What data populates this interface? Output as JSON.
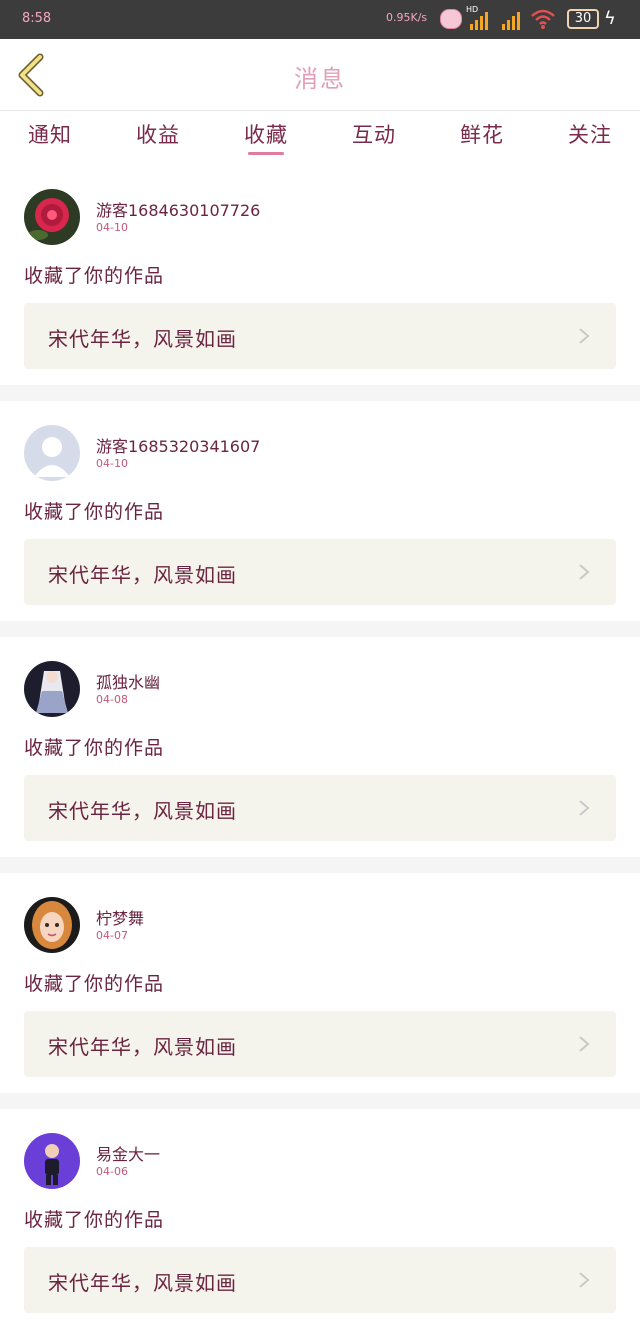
{
  "status_bar": {
    "time": "8:58",
    "net_speed": "0.95K/s",
    "hd_label": "HD",
    "battery": "30",
    "signal_color": "#f5a623"
  },
  "header": {
    "title": "消息",
    "back_icon": "chevron-left-icon",
    "back_color": "#f0e08a"
  },
  "tabs": [
    {
      "label": "通知",
      "active": false
    },
    {
      "label": "收益",
      "active": false
    },
    {
      "label": "收藏",
      "active": true
    },
    {
      "label": "互动",
      "active": false
    },
    {
      "label": "鲜花",
      "active": false
    },
    {
      "label": "关注",
      "active": false
    }
  ],
  "messages": [
    {
      "user": "游客1684630107726",
      "date": "04-10",
      "action": "收藏了你的作品",
      "work": "宋代年华，风景如画",
      "avatar": "rose-photo"
    },
    {
      "user": "游客1685320341607",
      "date": "04-10",
      "action": "收藏了你的作品",
      "work": "宋代年华，风景如画",
      "avatar": "default-avatar"
    },
    {
      "user": "孤独水幽",
      "date": "04-08",
      "action": "收藏了你的作品",
      "work": "宋代年华，风景如画",
      "avatar": "anime-figure"
    },
    {
      "user": "柠梦舞",
      "date": "04-07",
      "action": "收藏了你的作品",
      "work": "宋代年华，风景如画",
      "avatar": "cartoon-girl"
    },
    {
      "user": "易金大一",
      "date": "04-06",
      "action": "收藏了你的作品",
      "work": "宋代年华，风景如画",
      "avatar": "purple-figure"
    }
  ]
}
